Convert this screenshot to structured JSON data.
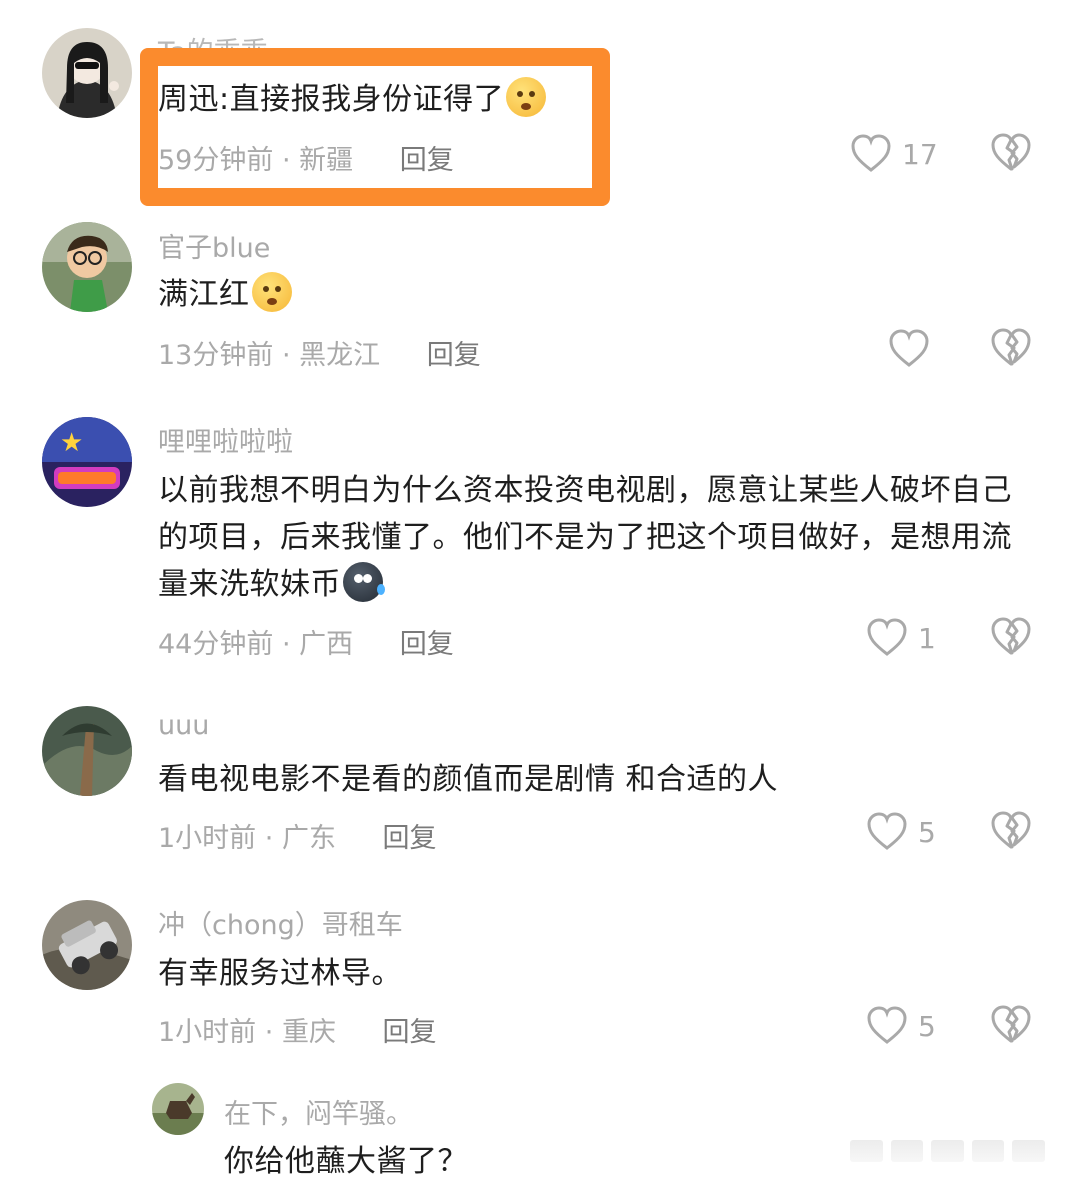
{
  "comments": [
    {
      "username": "Ta的乖乖",
      "text": "周迅:直接报我身份证得了",
      "emoji": "smirk-emoji",
      "time": "59分钟前",
      "location": "新疆",
      "reply_label": "回复",
      "likes": "17"
    },
    {
      "username": "官子blue",
      "text": "满江红",
      "emoji": "smirk-emoji",
      "time": "13分钟前",
      "location": "黑龙江",
      "reply_label": "回复",
      "likes": ""
    },
    {
      "username": "哩哩啦啦啦",
      "text": "以前我想不明白为什么资本投资电视剧，愿意让某些人破坏自己的项目，后来我懂了。他们不是为了把这个项目做好，是想用流量来洗软妹币",
      "emoji": "sweat-emoji",
      "time": "44分钟前",
      "location": "广西",
      "reply_label": "回复",
      "likes": "1"
    },
    {
      "username": "uuu",
      "text": "看电视电影不是看的颜值而是剧情 和合适的人",
      "time": "1小时前",
      "location": "广东",
      "reply_label": "回复",
      "likes": "5"
    },
    {
      "username": "冲（chong）哥租车",
      "text": "有幸服务过林导。",
      "time": "1小时前",
      "location": "重庆",
      "reply_label": "回复",
      "likes": "5"
    }
  ],
  "reply": {
    "username": "在下，闷竿骚。",
    "text": "你给他蘸大酱了？"
  },
  "colors": {
    "highlight": "#fb8b2d",
    "muted": "#a9a9a9",
    "text": "#1e1e1e"
  },
  "icons": [
    "heart-icon",
    "broken-heart-icon",
    "smirk-emoji",
    "sweat-emoji"
  ]
}
